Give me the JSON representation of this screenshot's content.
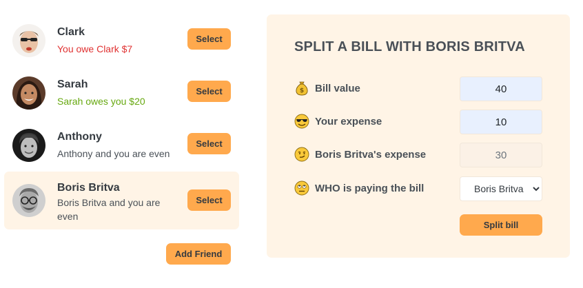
{
  "friends": [
    {
      "name": "Clark",
      "status": "You owe Clark $7",
      "status_color": "#e03131",
      "button": "Select",
      "selected": false
    },
    {
      "name": "Sarah",
      "status": "Sarah owes you $20",
      "status_color": "#66a80f",
      "button": "Select",
      "selected": false
    },
    {
      "name": "Anthony",
      "status": "Anthony and you are even",
      "status_color": "#495057",
      "button": "Select",
      "selected": false
    },
    {
      "name": "Boris Britva",
      "status": "Boris Britva and you are even",
      "status_color": "#495057",
      "button": "Select",
      "selected": true
    }
  ],
  "add_friend_label": "Add Friend",
  "split": {
    "title": "SPLIT A BILL WITH BORIS BRITVA",
    "bill_label": "Bill value",
    "bill_value": "40",
    "bill_icon": "money-bag-icon",
    "expense_label": "Your expense",
    "expense_value": "10",
    "expense_icon": "sunglasses-face-icon",
    "friend_expense_label": "Boris Britva's expense",
    "friend_expense_value": "30",
    "friend_expense_icon": "smirk-face-icon",
    "payer_label": "WHO is paying the bill",
    "payer_value": "Boris Britva",
    "payer_icon": "eye-roll-face-icon",
    "submit_label": "Split bill"
  },
  "colors": {
    "accent": "#ffa94d",
    "panel_bg": "#fff4e6",
    "owe": "#e03131",
    "owed": "#66a80f"
  }
}
